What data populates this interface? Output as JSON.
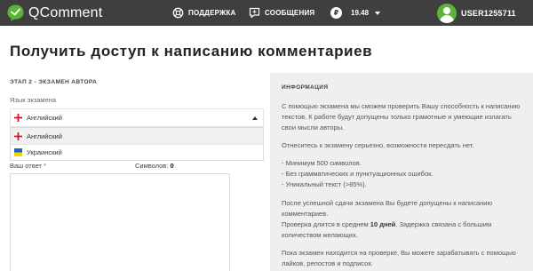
{
  "brand": {
    "name": "QComment"
  },
  "nav": {
    "support": "ПОДДЕРЖКА",
    "messages": "СООБЩЕНИЯ",
    "balance_currency": "₽",
    "balance": "19.48"
  },
  "user": {
    "name": "USER1255711"
  },
  "page": {
    "title": "Получить доступ к написанию комментариев"
  },
  "exam": {
    "step": "ЭТАП 2 - ЭКЗАМЕН АВТОРА",
    "language_label": "Язык экзамена",
    "language_selected": "Английский",
    "language_options": [
      "Английский",
      "Украинский"
    ],
    "answer_label": "Ваш ответ",
    "required_mark": "*",
    "chars_label": "Символов:",
    "chars_count": "0"
  },
  "info": {
    "heading": "ИНФОРМАЦИЯ",
    "p1": "С помощью экзамена мы сможем проверить Вашу способность к написанию текстов. К работе будут допущены только грамотные и умеющие излагать свои мысли авторы.",
    "p2": "Отнеситесь к экзамену серьезно, возможности пересдать нет.",
    "req1": "- Минимум 500 символов.",
    "req2": "- Без грамматических и пунктуационных ошибок.",
    "req3": "- Уникальный текст (>85%).",
    "p3": "После успешной сдачи экзамена Вы будете допущены к написанию комментариев.",
    "p4_pre": "Проверка длится в среднем ",
    "p4_bold": "10 дней",
    "p4_post": ". Задержка связана с большим количеством желающих.",
    "p5": "Пока экзамен находится на проверке, Вы можете зарабатывать с помощью лайков, репостов и подписок."
  },
  "colors": {
    "topbar": "#3f3f3f",
    "avatar": "#5cb338",
    "panel": "#efefef"
  },
  "icons": [
    "qcomment-logo-icon",
    "support-icon",
    "messages-icon",
    "ruble-coin-icon",
    "chevron-down-icon",
    "avatar-icon",
    "uk-flag-icon",
    "ukraine-flag-icon",
    "caret-up-icon"
  ]
}
